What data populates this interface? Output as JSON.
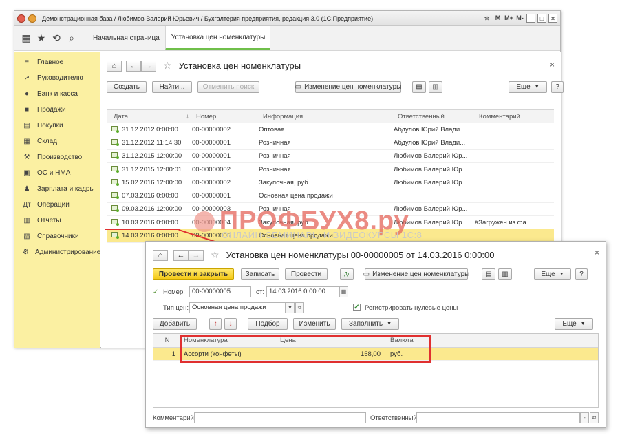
{
  "window": {
    "title": "Демонстрационная база / Любимов Валерий Юрьевич / Бухгалтерия предприятия, редакция 3.0  (1С:Предприятие)",
    "tb_buttons": [
      "M",
      "M+",
      "M-"
    ]
  },
  "tabs": [
    {
      "label": "Начальная страница"
    },
    {
      "label": "Установка цен номенклатуры"
    }
  ],
  "sidebar": {
    "items": [
      {
        "label": "Главное",
        "icon": "≡"
      },
      {
        "label": "Руководителю",
        "icon": "↗"
      },
      {
        "label": "Банк и касса",
        "icon": "●"
      },
      {
        "label": "Продажи",
        "icon": "■"
      },
      {
        "label": "Покупки",
        "icon": "▤"
      },
      {
        "label": "Склад",
        "icon": "▦"
      },
      {
        "label": "Производство",
        "icon": "⚒"
      },
      {
        "label": "ОС и НМА",
        "icon": "▣"
      },
      {
        "label": "Зарплата и кадры",
        "icon": "♟"
      },
      {
        "label": "Операции",
        "icon": "Дт"
      },
      {
        "label": "Отчеты",
        "icon": "▥"
      },
      {
        "label": "Справочники",
        "icon": "▧"
      },
      {
        "label": "Администрирование",
        "icon": "⚙"
      }
    ]
  },
  "list_form": {
    "title": "Установка цен номенклатуры",
    "buttons": {
      "create": "Создать",
      "find": "Найти...",
      "cancel_search": "Отменить поиск",
      "change_prices": "Изменение цен номенклатуры",
      "more": "Еще",
      "help": "?"
    },
    "columns": [
      "Дата",
      "Номер",
      "Информация",
      "Ответственный",
      "Комментарий"
    ],
    "sort_arrow": "↓",
    "rows": [
      {
        "date": "31.12.2012 0:00:00",
        "number": "00-00000002",
        "info": "Оптовая",
        "resp": "Абдулов Юрий Влади...",
        "comment": ""
      },
      {
        "date": "31.12.2012 11:14:30",
        "number": "00-00000001",
        "info": "Розничная",
        "resp": "Абдулов Юрий Влади...",
        "comment": ""
      },
      {
        "date": "31.12.2015 12:00:00",
        "number": "00-00000001",
        "info": "Розничная",
        "resp": "Любимов Валерий Юр...",
        "comment": ""
      },
      {
        "date": "31.12.2015 12:00:01",
        "number": "00-00000002",
        "info": "Розничная",
        "resp": "Любимов Валерий Юр...",
        "comment": ""
      },
      {
        "date": "15.02.2016 12:00:00",
        "number": "00-00000002",
        "info": "Закупочная, руб.",
        "resp": "Любимов Валерий Юр...",
        "comment": ""
      },
      {
        "date": "07.03.2016 0:00:00",
        "number": "00-00000001",
        "info": "Основная цена продажи",
        "resp": "",
        "comment": ""
      },
      {
        "date": "09.03.2016 12:00:00",
        "number": "00-00000003",
        "info": "Розничная",
        "resp": "Любимов Валерий Юр...",
        "comment": ""
      },
      {
        "date": "10.03.2016 0:00:00",
        "number": "00-00000004",
        "info": "Закупочная, руб.",
        "resp": "Любимов Валерий Юр...",
        "comment": "#Загружен из фа..."
      },
      {
        "date": "14.03.2016 0:00:00",
        "number": "00-00000005",
        "info": "Основная цена продажи",
        "resp": "",
        "comment": "",
        "selected": true
      }
    ]
  },
  "watermark": {
    "main": "ПРОФБУХ8.ру",
    "sub": "ОНЛАЙН-СЕМИНАРЫ И ВИДЕОКУРСЫ 1С:8"
  },
  "doc_form": {
    "title": "Установка цен номенклатуры 00-00000005 от 14.03.2016 0:00:00",
    "buttons": {
      "post_close": "Провести и закрыть",
      "save": "Записать",
      "post": "Провести",
      "change_prices": "Изменение цен номенклатуры",
      "more": "Еще",
      "help": "?",
      "add": "Добавить",
      "pick": "Подбор",
      "edit": "Изменить",
      "fill": "Заполнить",
      "more2": "Еще"
    },
    "number_label": "Номер:",
    "number_value": "00-00000005",
    "date_label": "от:",
    "date_value": "14.03.2016  0:00:00",
    "price_type_label": "Тип цен:",
    "price_type_value": "Основная цена продажи",
    "register_zero_label": "Регистрировать нулевые цены",
    "register_zero_checked": true,
    "columns": [
      "N",
      "Номенклатура",
      "Цена",
      "Валюта"
    ],
    "rows": [
      {
        "n": "1",
        "nom": "Ассорти (конфеты)",
        "price": "158,00",
        "currency": "руб."
      }
    ],
    "comment_label": "Комментарий:",
    "comment_value": "",
    "responsible_label": "Ответственный:",
    "responsible_value": ""
  },
  "colors": {
    "sidebar_bg": "#fbf0a2",
    "primary_button": "#f4c813",
    "selected_row": "#fbe98e",
    "highlight_red": "#e03030",
    "active_tab_underline": "#6fbf4a"
  }
}
